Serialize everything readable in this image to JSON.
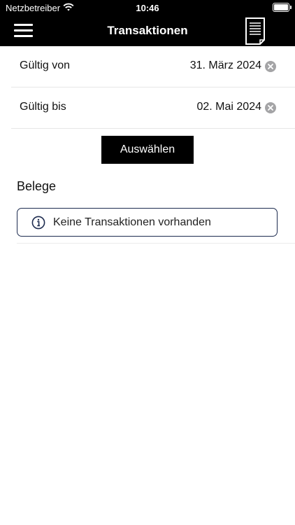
{
  "status_bar": {
    "carrier": "Netzbetreiber",
    "time": "10:46"
  },
  "nav": {
    "title": "Transaktionen"
  },
  "filters": {
    "from": {
      "label": "Gültig von",
      "value": "31. März 2024"
    },
    "to": {
      "label": "Gültig bis",
      "value": "02. Mai 2024"
    }
  },
  "select_button": {
    "label": "Auswählen"
  },
  "section": {
    "title": "Belege"
  },
  "empty_notice": {
    "text": "Keine Transaktionen vorhanden"
  },
  "colors": {
    "bar": "#000000",
    "notice_border": "#1d2b4f",
    "clear_icon": "#a4a4a6"
  }
}
